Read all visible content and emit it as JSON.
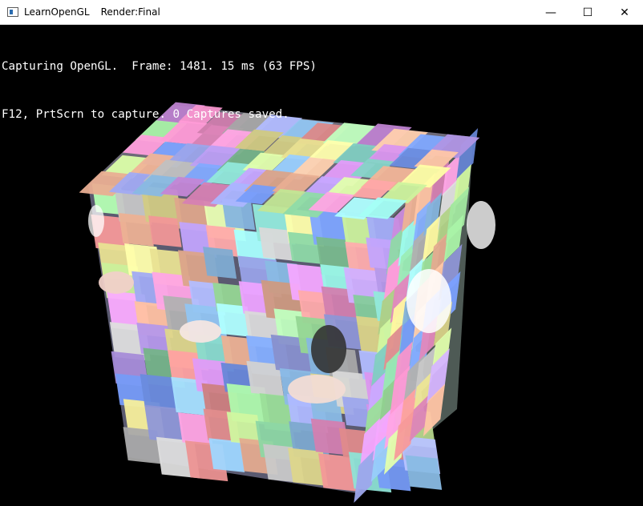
{
  "window": {
    "title": "LearnOpenGL",
    "subtitle": "Render:Final",
    "controls": {
      "minimize": "—",
      "maximize": "☐",
      "close": "✕"
    }
  },
  "overlay": {
    "line1": "Capturing OpenGL.  Frame: 1481. 15 ms (63 FPS)",
    "line2": "F12, PrtScrn to capture. 0 Captures saved."
  },
  "scene": {
    "palette": [
      "#ff9ad5",
      "#9ad0ff",
      "#b2ffb0",
      "#fff7a0",
      "#c5a6ff",
      "#ffbfa0",
      "#a0fff0",
      "#e9a0ff",
      "#a9b3ff",
      "#d7ffa5",
      "#ff9f9f",
      "#8ed9a6",
      "#cfcfcf",
      "#7aa0ff"
    ]
  }
}
